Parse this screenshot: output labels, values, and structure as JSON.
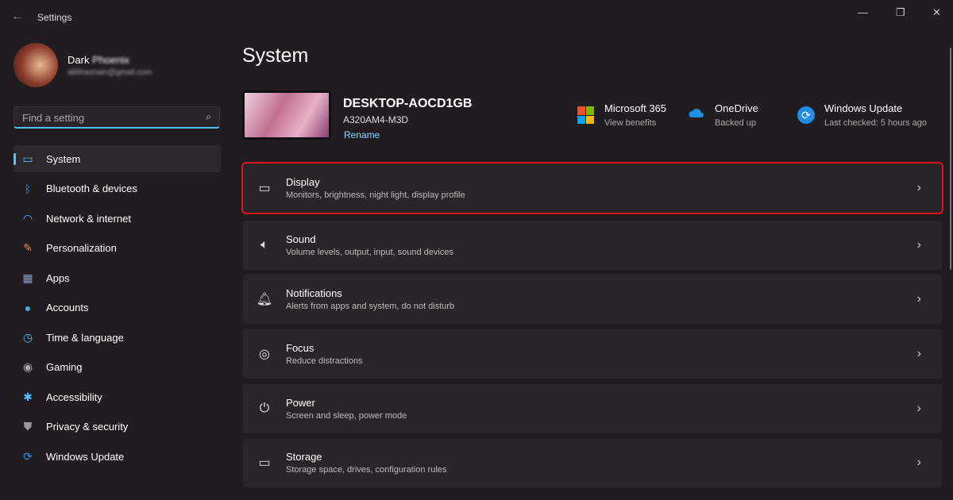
{
  "window": {
    "title": "Settings",
    "back": "←",
    "minimize": "—",
    "maximize": "❐",
    "close": "✕"
  },
  "user": {
    "first": "Dark",
    "last": "Phoenix",
    "email": "ali6hasnain@gmail.com"
  },
  "search": {
    "placeholder": "Find a setting",
    "icon": "⌕"
  },
  "nav": [
    {
      "label": "System",
      "icon": "▭",
      "color": "#4cc2ff"
    },
    {
      "label": "Bluetooth & devices",
      "icon": "ᛒ",
      "color": "#2f8fff"
    },
    {
      "label": "Network & internet",
      "icon": "◠",
      "color": "#4cc2ff"
    },
    {
      "label": "Personalization",
      "icon": "✎",
      "color": "#e98a5a"
    },
    {
      "label": "Apps",
      "icon": "▦",
      "color": "#8aa0c8"
    },
    {
      "label": "Accounts",
      "icon": "●",
      "color": "#3fb0e0"
    },
    {
      "label": "Time & language",
      "icon": "◷",
      "color": "#4cc2ff"
    },
    {
      "label": "Gaming",
      "icon": "◉",
      "color": "#aaa"
    },
    {
      "label": "Accessibility",
      "icon": "✱",
      "color": "#4cc2ff"
    },
    {
      "label": "Privacy & security",
      "icon": "⛊",
      "color": "#999"
    },
    {
      "label": "Windows Update",
      "icon": "⟳",
      "color": "#2f8fff"
    }
  ],
  "page": {
    "title": "System"
  },
  "device": {
    "name": "DESKTOP-AOCD1GB",
    "model": "A320AM4-M3D",
    "rename": "Rename"
  },
  "quick": [
    {
      "title": "Microsoft 365",
      "sub": "View benefits"
    },
    {
      "title": "OneDrive",
      "sub": "Backed up"
    },
    {
      "title": "Windows Update",
      "sub": "Last checked: 5 hours ago"
    }
  ],
  "cards": [
    {
      "title": "Display",
      "sub": "Monitors, brightness, night light, display profile",
      "icon": "▭"
    },
    {
      "title": "Sound",
      "sub": "Volume levels, output, input, sound devices",
      "icon": "🔈︎"
    },
    {
      "title": "Notifications",
      "sub": "Alerts from apps and system, do not disturb",
      "icon": "🔔︎"
    },
    {
      "title": "Focus",
      "sub": "Reduce distractions",
      "icon": "◎"
    },
    {
      "title": "Power",
      "sub": "Screen and sleep, power mode",
      "icon": "⏻"
    },
    {
      "title": "Storage",
      "sub": "Storage space, drives, configuration rules",
      "icon": "▭"
    }
  ],
  "chevron": "›"
}
